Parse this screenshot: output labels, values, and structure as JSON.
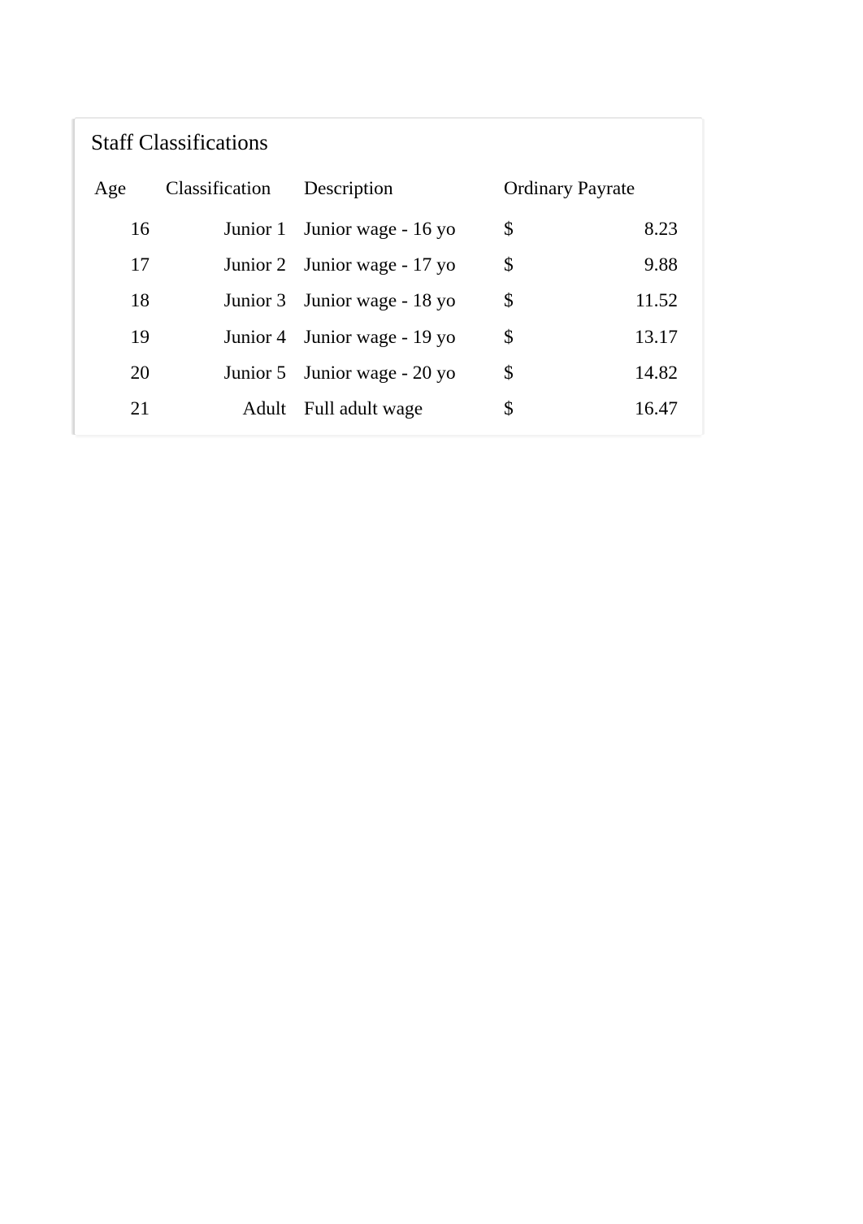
{
  "title": "Staff Classifications",
  "columns": {
    "age": "Age",
    "classification": "Classification",
    "description": "Description",
    "payrate": "Ordinary Payrate"
  },
  "currency_symbol": "$",
  "rows": [
    {
      "age": "16",
      "classification": "Junior 1",
      "description": "Junior wage - 16 yo",
      "rate": "8.23"
    },
    {
      "age": "17",
      "classification": "Junior 2",
      "description": "Junior wage - 17 yo",
      "rate": "9.88"
    },
    {
      "age": "18",
      "classification": "Junior 3",
      "description": "Junior wage - 18 yo",
      "rate": "11.52"
    },
    {
      "age": "19",
      "classification": "Junior 4",
      "description": "Junior wage - 19 yo",
      "rate": "13.17"
    },
    {
      "age": "20",
      "classification": "Junior 5",
      "description": "Junior wage - 20 yo",
      "rate": "14.82"
    },
    {
      "age": "21",
      "classification": "Adult",
      "description": "Full adult wage",
      "rate": "16.47"
    }
  ]
}
